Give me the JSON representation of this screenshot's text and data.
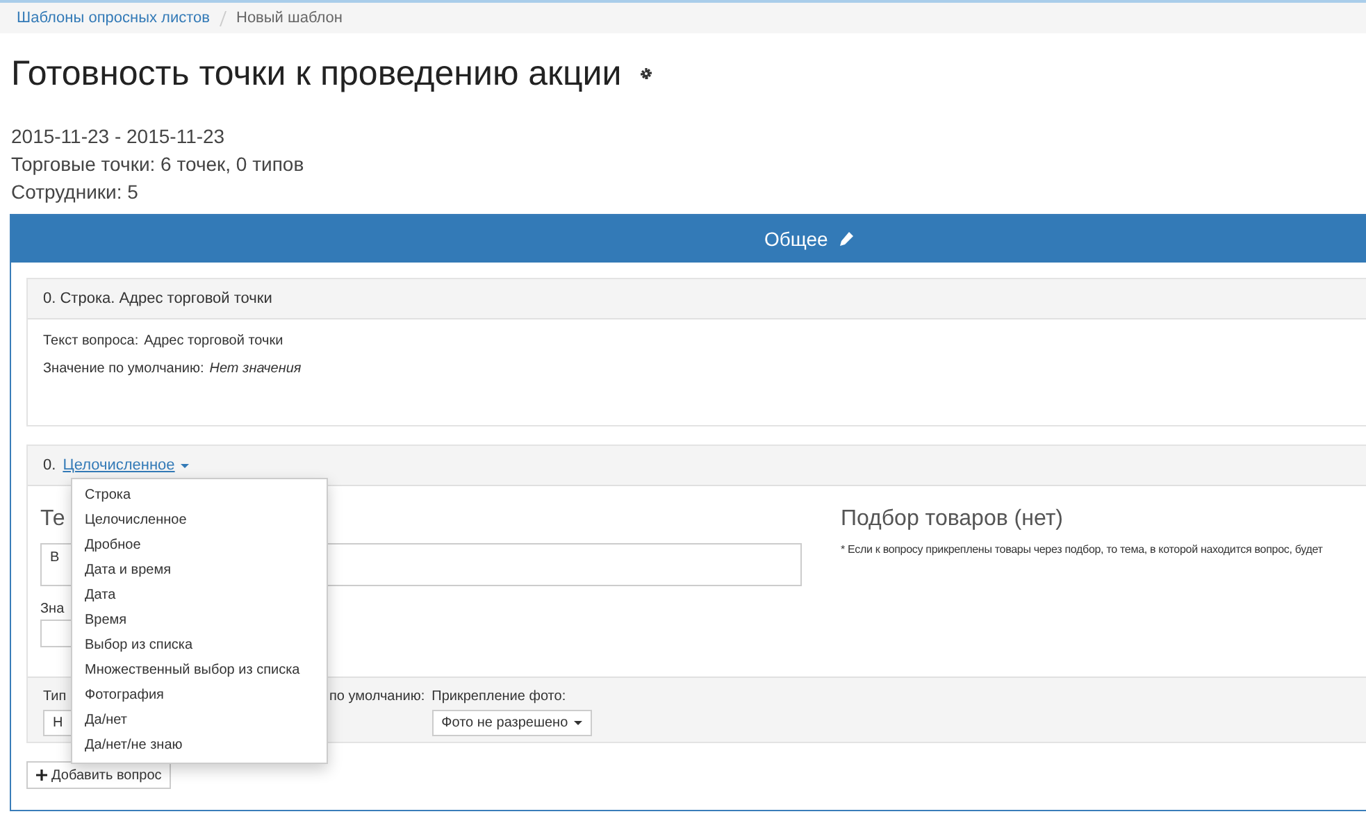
{
  "breadcrumbs": [
    {
      "label": "Шаблоны опросных листов",
      "kind": "link"
    },
    {
      "label": "Новый шаблон",
      "kind": "current"
    }
  ],
  "title": "Готовность точки к проведению акции",
  "meta": [
    "2015-11-23 - 2015-11-23",
    "Торговые точки: 6 точек, 0 типов",
    "Сотрудники: 5"
  ],
  "section": {
    "title": "Общее"
  },
  "questions": [
    {
      "kind": "view",
      "number": "0.",
      "header": "Строка. Адрес торговой точки",
      "text_label": "Текст вопроса:",
      "text_value": "Адрес торговой точки",
      "default_label": "Значение по умолчанию:",
      "default_value": "Нет значения"
    },
    {
      "kind": "edit",
      "number": "0.",
      "type_value": "Целочисленное",
      "heading": "Те",
      "textarea_value": "В",
      "default_label": "Зна",
      "products_title": "Подбор товаров  (нет)",
      "products_note": "* Если к вопросу прикреплены товары через подбор, то тема, в которой находится вопрос, будет",
      "footer": {
        "type_label": "Тип",
        "type_button": "Н",
        "default_label": "по умолчанию:",
        "photo_label": "Прикрепление фото:",
        "photo_button": "Фото не разрешено"
      },
      "menu": [
        "Строка",
        "Целочисленное",
        "Дробное",
        "Дата и время",
        "Дата",
        "Время",
        "Выбор из списка",
        "Множественный выбор из списка",
        "Фотография",
        "Да/нет",
        "Да/нет/не знаю"
      ]
    }
  ],
  "add_button": "Добавить вопрос"
}
